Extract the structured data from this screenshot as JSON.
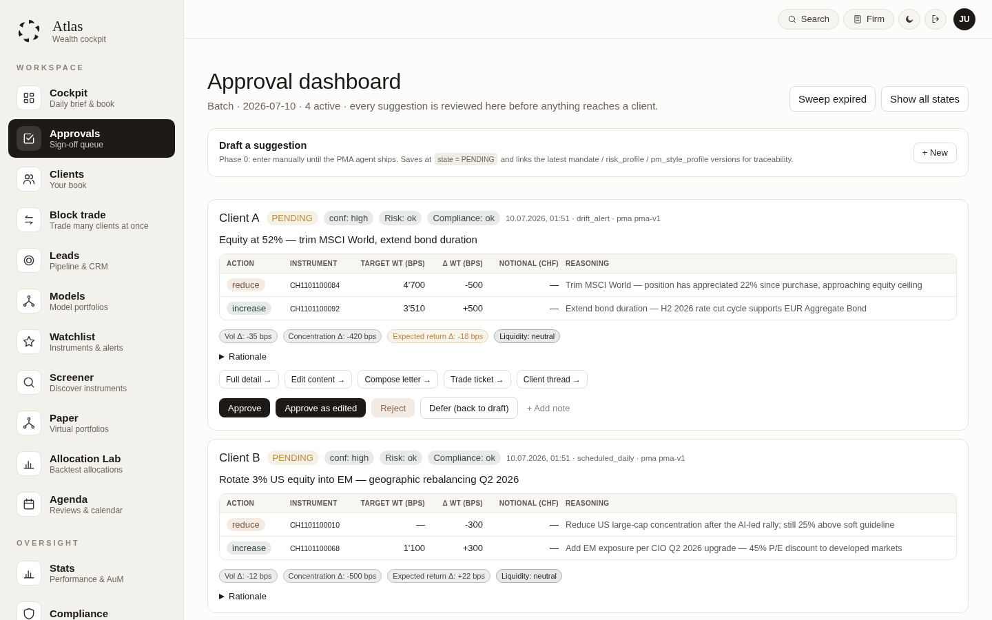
{
  "brand": {
    "name": "Atlas",
    "tagline": "Wealth cockpit"
  },
  "sidebar": {
    "sections": [
      {
        "heading": "WORKSPACE",
        "items": [
          {
            "label": "Cockpit",
            "sub": "Daily brief & book",
            "selected": false
          },
          {
            "label": "Approvals",
            "sub": "Sign-off queue",
            "selected": true
          },
          {
            "label": "Clients",
            "sub": "Your book",
            "selected": false
          },
          {
            "label": "Block trade",
            "sub": "Trade many clients at once",
            "selected": false
          },
          {
            "label": "Leads",
            "sub": "Pipeline & CRM",
            "selected": false
          },
          {
            "label": "Models",
            "sub": "Model portfolios",
            "selected": false
          },
          {
            "label": "Watchlist",
            "sub": "Instruments & alerts",
            "selected": false
          },
          {
            "label": "Screener",
            "sub": "Discover instruments",
            "selected": false
          },
          {
            "label": "Paper",
            "sub": "Virtual portfolios",
            "selected": false
          },
          {
            "label": "Allocation Lab",
            "sub": "Backtest allocations",
            "selected": false
          },
          {
            "label": "Agenda",
            "sub": "Reviews & calendar",
            "selected": false
          }
        ]
      },
      {
        "heading": "OVERSIGHT",
        "items": [
          {
            "label": "Stats",
            "sub": "Performance & AuM",
            "selected": false
          },
          {
            "label": "Compliance",
            "selected": false
          }
        ]
      }
    ]
  },
  "topbar": {
    "search": "Search",
    "firm": "Firm",
    "avatar": "JU"
  },
  "page": {
    "title": "Approval dashboard",
    "subtitle": "Batch · 2026-07-10 · 4 active · every suggestion is reviewed here before anything reaches a client.",
    "actions": [
      "Sweep expired",
      "Show all states"
    ]
  },
  "draft": {
    "title": "Draft a suggestion",
    "text_before": "Phase 0: enter manually until the PMA agent ships. Saves at",
    "code": "state = PENDING",
    "text_after": "and links the latest mandate / risk_profile / pm_style_profile versions for traceability.",
    "button": "+ New"
  },
  "suggestions": [
    {
      "client": "Client A",
      "badges": [
        {
          "label": "PENDING",
          "color": "#b8893a"
        },
        {
          "label": "conf: high",
          "color": "#3e4b44"
        },
        {
          "label": "Risk: ok",
          "color": "#3e4b44"
        },
        {
          "label": "Compliance: ok",
          "color": "#3e4b44"
        }
      ],
      "meta": "10.07.2026, 01:51 · drift_alert · pma pma-v1",
      "headline": "Equity at 52% — trim MSCI World, extend bond duration",
      "columns": [
        "ACTION",
        "INSTRUMENT",
        "TARGET WT (BPS)",
        "Δ WT (BPS)",
        "NOTIONAL (CHF)",
        "REASONING"
      ],
      "rows": [
        {
          "action": "reduce",
          "kind": "reduce",
          "instrument": "CH1101100084",
          "target": "4'700",
          "delta": "-500",
          "notional": "—",
          "reasoning": "Trim MSCI World — position has appreciated 22% since purchase, approaching equity ceiling"
        },
        {
          "action": "increase",
          "kind": "increase",
          "instrument": "CH1101100092",
          "target": "3'510",
          "delta": "+500",
          "notional": "—",
          "reasoning": "Extend bond duration — H2 2026 rate cut cycle supports EUR Aggregate Bond"
        }
      ],
      "metrics": [
        {
          "label": "Vol Δ: -35 bps",
          "color": "#3e4b44"
        },
        {
          "label": "Concentration Δ: -420 bps",
          "color": "#3e4b44"
        },
        {
          "label": "Expected return Δ: -18 bps",
          "color": "#b8893a"
        },
        {
          "label": "Liquidity: neutral",
          "color": "#1c1917"
        }
      ],
      "rationale": "Rationale",
      "expanded": false,
      "links": [
        "Full detail →",
        "Edit content →",
        "Compose letter →",
        "Trade ticket →",
        "Client thread →"
      ],
      "decisions": [
        {
          "label": "Approve",
          "kind": "primary"
        },
        {
          "label": "Approve as edited",
          "kind": "primary"
        },
        {
          "label": "Reject",
          "kind": "danger"
        },
        {
          "label": "Defer (back to draft)",
          "kind": "outline"
        },
        {
          "label": "+ Add note",
          "kind": "plain"
        }
      ]
    },
    {
      "client": "Client B",
      "badges": [
        {
          "label": "PENDING",
          "color": "#b8893a"
        },
        {
          "label": "conf: high",
          "color": "#3e4b44"
        },
        {
          "label": "Risk: ok",
          "color": "#3e4b44"
        },
        {
          "label": "Compliance: ok",
          "color": "#3e4b44"
        }
      ],
      "meta": "10.07.2026, 01:51 · scheduled_daily · pma pma-v1",
      "headline": "Rotate 3% US equity into EM — geographic rebalancing Q2 2026",
      "columns": [
        "ACTION",
        "INSTRUMENT",
        "TARGET WT (BPS)",
        "Δ WT (BPS)",
        "NOTIONAL (CHF)",
        "REASONING"
      ],
      "rows": [
        {
          "action": "reduce",
          "kind": "reduce",
          "instrument": "CH1101100010",
          "target": "—",
          "delta": "-300",
          "notional": "—",
          "reasoning": "Reduce US large-cap concentration after the AI-led rally; still 25% above soft guideline"
        },
        {
          "action": "increase",
          "kind": "increase",
          "instrument": "CH1101100068",
          "target": "1'100",
          "delta": "+300",
          "notional": "—",
          "reasoning": "Add EM exposure per CIO Q2 2026 upgrade — 45% P/E discount to developed markets"
        }
      ],
      "metrics": [
        {
          "label": "Vol Δ: -12 bps",
          "color": "#3e4b44"
        },
        {
          "label": "Concentration Δ: -500 bps",
          "color": "#3e4b44"
        },
        {
          "label": "Expected return Δ: +22 bps",
          "color": "#3e4b44"
        },
        {
          "label": "Liquidity: neutral",
          "color": "#1c1917"
        }
      ],
      "rationale": "Rationale",
      "expanded": false
    }
  ]
}
